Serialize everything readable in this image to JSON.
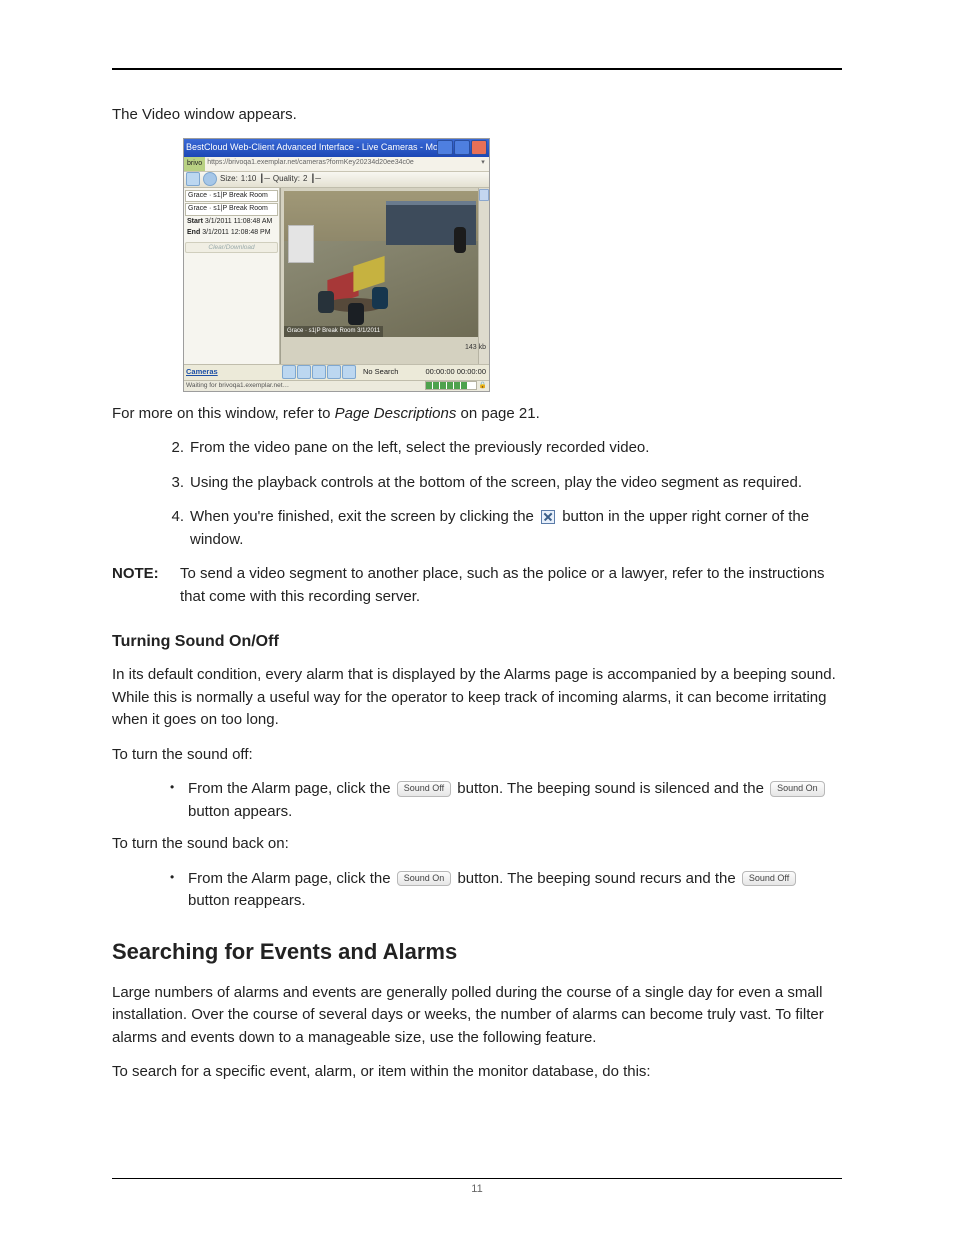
{
  "intro_appears": "The Video window appears.",
  "screenshot": {
    "title": "BestCloud Web-Client Advanced Interface - Live Cameras - Mozilla Firefox",
    "url_lead": "brivo",
    "url": "https://brivoqa1.exemplar.net/cameras?formKey20234d20ee34c0e",
    "toolbar_size_label": "Size:",
    "toolbar_size_value": "1:10",
    "toolbar_quality_label": "Quality:",
    "toolbar_quality_value": "2",
    "sidebar": {
      "camera1": "Grace · s1|P Break Room",
      "camera2": "Grace · s1|P Break Room",
      "start_label": "Start",
      "start_value": "3/1/2011 11:08:48 AM",
      "end_label": "End",
      "end_value": "3/1/2011 12:08:48 PM",
      "control_btn": "Clear/Download"
    },
    "video_caption": "Grace · s1|P Break Room 3/1/2011",
    "kb": "143 kb",
    "controls": {
      "cameras": "Cameras",
      "status": "No Search",
      "timecode": "00:00:00 00:00:00"
    },
    "status_left": "Waiting for brivoqa1.exemplar.net…"
  },
  "refer_line_a": "For more on this window, refer to ",
  "refer_italic": "Page Descriptions",
  "refer_line_b": " on page 21.",
  "steps": {
    "s2": "From the video pane on the left, select the previously recorded video.",
    "s3": "Using the playback controls at the bottom of the screen, play the video segment as required.",
    "s4a": "When you're finished, exit the screen by clicking the ",
    "s4b": " button in the upper right corner of the window."
  },
  "note_label": "NOTE:",
  "note_text": "To send a video segment to another place, such as the police or a lawyer, refer to the instructions that come with this recording server.",
  "sound_heading": "Turning Sound On/Off",
  "sound_intro": "In its default condition, every alarm that is displayed by the Alarms page is accompanied by a beeping sound. While this is normally a useful way for the operator to keep track of incoming alarms, it can become irritating when it goes on too long.",
  "sound_off_lead": "To turn the sound off:",
  "sound_off_item_a": "From the Alarm page, click the ",
  "sound_off_item_b": " button. The beeping sound is silenced and the ",
  "sound_off_item_c": " button appears.",
  "sound_on_lead": "To turn the sound back on:",
  "sound_on_item_a": "From the Alarm page, click the ",
  "sound_on_item_b": " button. The beeping sound recurs and the ",
  "sound_on_item_c": " button reappears.",
  "btn_sound_off": "Sound Off",
  "btn_sound_on": "Sound On",
  "search_heading": "Searching for Events and Alarms",
  "search_intro": "Large numbers of alarms and events are generally polled during the course of a single day for even a small installation. Over the course of several days or weeks, the number of alarms can become truly vast. To filter alarms and events down to a manageable size, use the following feature.",
  "search_do": "To search for a specific event, alarm, or item within the monitor database, do this:",
  "page_number": "11"
}
